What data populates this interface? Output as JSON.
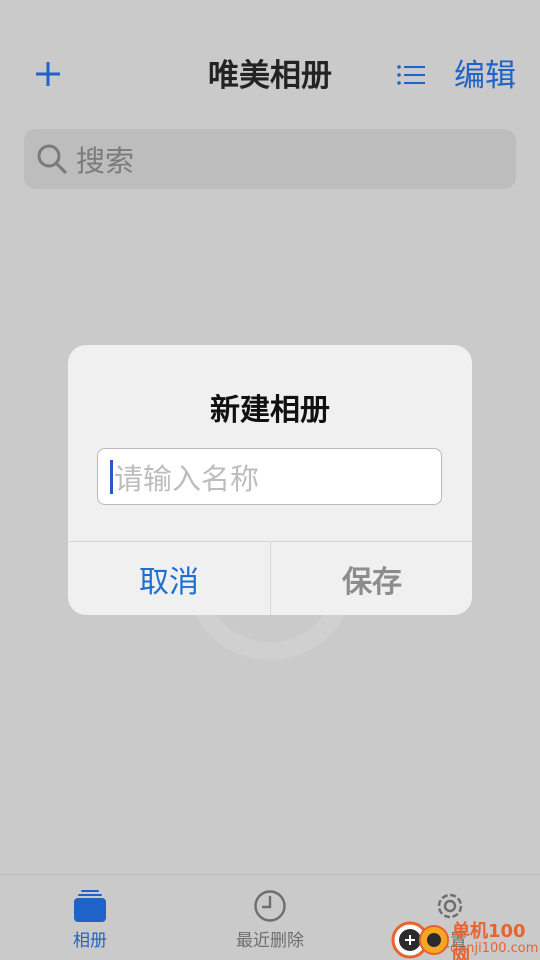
{
  "nav": {
    "title": "唯美相册",
    "edit_label": "编辑",
    "add_icon": "plus-icon",
    "list_icon": "list-icon"
  },
  "search": {
    "placeholder": "搜索"
  },
  "dialog": {
    "title": "新建相册",
    "input_value": "",
    "input_placeholder": "请输入名称",
    "cancel_label": "取消",
    "save_label": "保存"
  },
  "tabbar": {
    "tabs": [
      {
        "label": "相册",
        "icon": "albums-icon",
        "active": true
      },
      {
        "label": "最近删除",
        "icon": "clock-icon",
        "active": false
      },
      {
        "label": "设置",
        "icon": "gear-icon",
        "active": false
      }
    ]
  },
  "watermark": {
    "brand": "单机100网",
    "url": "danji100.com"
  },
  "colors": {
    "accent": "#1f63c8",
    "background": "#cacaca",
    "watermark": "#e8632f"
  }
}
